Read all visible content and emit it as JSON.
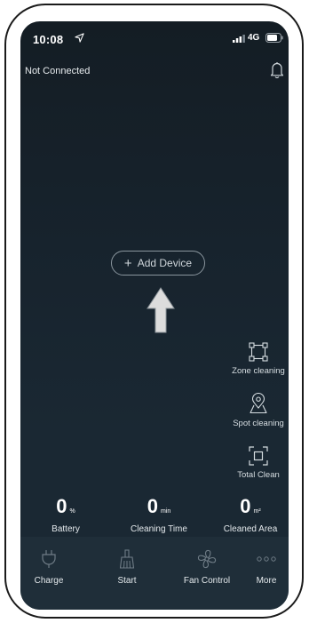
{
  "status_bar": {
    "time": "10:08",
    "network": "4G",
    "icons": [
      "location-arrow-icon",
      "signal-icon",
      "battery-icon"
    ]
  },
  "header": {
    "connection_status": "Not Connected",
    "notification_icon": "bell-icon"
  },
  "main": {
    "add_device_label": "Add Device",
    "add_device_icon": "+",
    "hint_icon": "up-arrow-icon"
  },
  "side_actions": [
    {
      "label": "Zone cleaning",
      "icon": "zone-icon"
    },
    {
      "label": "Spot cleaning",
      "icon": "map-pin-icon"
    },
    {
      "label": "Total Clean",
      "icon": "frame-icon"
    }
  ],
  "stats": [
    {
      "value": "0",
      "unit": "%",
      "label": "Battery"
    },
    {
      "value": "0",
      "unit": "min",
      "label": "Cleaning Time"
    },
    {
      "value": "0",
      "unit": "m²",
      "label": "Cleaned Area"
    }
  ],
  "bottom_nav": [
    {
      "label": "Charge",
      "icon": "plug-icon"
    },
    {
      "label": "Start",
      "icon": "broom-icon"
    },
    {
      "label": "Fan Control",
      "icon": "fan-icon"
    },
    {
      "label": "More",
      "icon": "more-dots-icon"
    }
  ],
  "colors": {
    "background_top": "#141d24",
    "background_bottom": "#1a2833",
    "nav_background": "#1f2e39",
    "text": "#ffffff",
    "muted_text": "#cfd6db",
    "icon_muted": "#6f7c86",
    "arrow": "#dcdcdc"
  }
}
